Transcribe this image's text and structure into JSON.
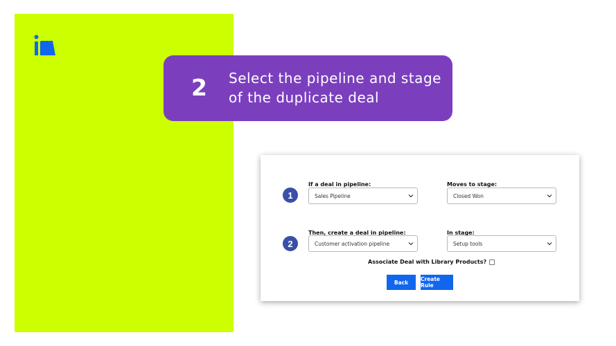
{
  "colors": {
    "panel": "#ccff00",
    "banner": "#7b3fbe",
    "badge": "#3a4fa8",
    "button": "#1166ee",
    "logo": "#1166ee"
  },
  "logo": {
    "icon": "brand-logo-icon"
  },
  "banner": {
    "step_number": "2",
    "line1": "Select the pipeline and stage",
    "line2": "of the duplicate deal"
  },
  "form": {
    "row1": {
      "badge": "1",
      "pipeline_label": "If a deal in pipeline:",
      "pipeline_value": "Sales Pipeline",
      "stage_label": "Moves to stage:",
      "stage_value": "Closed Won"
    },
    "row2": {
      "badge": "2",
      "pipeline_label": "Then, create a deal in pipeline:",
      "pipeline_value": "Customer activation pipeline",
      "stage_label": "In stage:",
      "stage_value": "Setup tools"
    },
    "associate_label": "Associate Deal with Library Products?",
    "associate_checked": false,
    "back_label": "Back",
    "create_label": "Create Rule"
  }
}
